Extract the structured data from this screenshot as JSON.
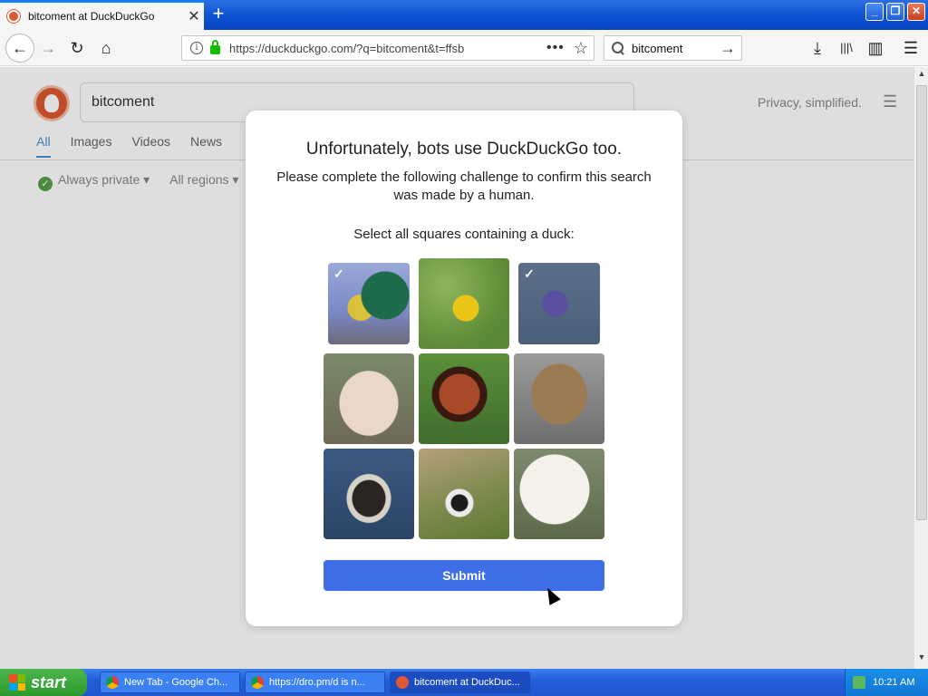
{
  "browser": {
    "tab_title": "bitcoment at DuckDuckGo",
    "tab_close": "✕",
    "new_tab": "+",
    "url": "https://duckduckgo.com/?q=bitcoment&t=ffsb",
    "search_query": "bitcoment",
    "icons": {
      "back": "←",
      "forward": "→",
      "reload": "↻",
      "home": "⌂",
      "more": "•••",
      "star": "☆",
      "go": "→",
      "download": "⤓",
      "library": "|||\\",
      "sidebar": "▥",
      "menu": "☰"
    },
    "window_buttons": {
      "minimize": "_",
      "maximize": "❐",
      "close": "✕"
    }
  },
  "ddg": {
    "search_text": "bitcoment",
    "privacy_text": "Privacy, simplified.",
    "hamburger": "☰",
    "tabs": [
      "All",
      "Images",
      "Videos",
      "News"
    ],
    "filters": [
      "Always private ▾",
      "All regions ▾"
    ],
    "check": "✓"
  },
  "challenge": {
    "title": "Unfortunately, bots use DuckDuckGo too.",
    "subtitle": "Please complete the following challenge to confirm this search was made by a human.",
    "prompt": "Select all squares containing a duck:",
    "tiles": [
      {
        "subject": "mallard duck",
        "selected": true
      },
      {
        "subject": "yellow flower",
        "selected": false
      },
      {
        "subject": "duck in water",
        "selected": true
      },
      {
        "subject": "bear",
        "selected": false
      },
      {
        "subject": "red panda",
        "selected": false
      },
      {
        "subject": "brown object",
        "selected": false
      },
      {
        "subject": "swimming duck",
        "selected": false
      },
      {
        "subject": "panda",
        "selected": false
      },
      {
        "subject": "polar bear with cub",
        "selected": false
      }
    ],
    "check_mark": "✓",
    "submit_label": "Submit"
  },
  "taskbar": {
    "start_label": "start",
    "tasks": [
      "New Tab - Google Ch...",
      "https://dro.pm/d is n...",
      "bitcoment at DuckDuc..."
    ],
    "clock": "10:21 AM"
  },
  "scrollbar": {
    "up": "▲",
    "down": "▼"
  },
  "colors": {
    "submit": "#3f6fe6",
    "ddg_orange": "#de5833",
    "taskbar": "#245edb"
  }
}
